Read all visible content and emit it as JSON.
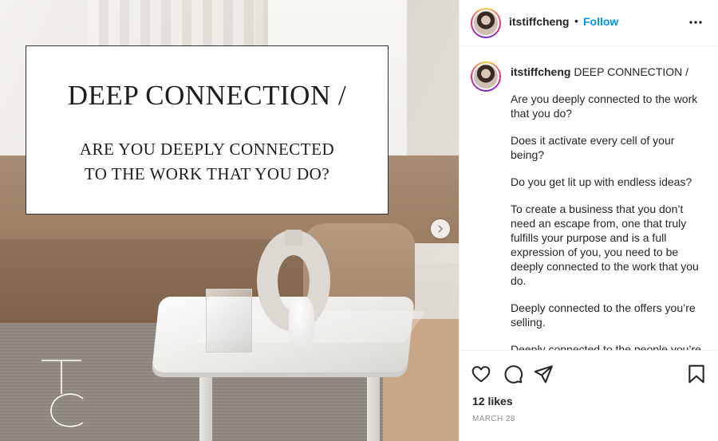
{
  "post_image": {
    "card_title": "DEEP CONNECTION /",
    "card_subtitle_line1": "ARE YOU DEEPLY CONNECTED",
    "card_subtitle_line2": "TO THE WORK THAT YOU DO?",
    "logo_letters": "TC"
  },
  "header": {
    "username": "itstiffcheng",
    "separator": "•",
    "follow_label": "Follow",
    "more_icon": "more-horizontal-icon"
  },
  "caption": {
    "username": "itstiffcheng",
    "first_line": "DEEP CONNECTION /",
    "paragraphs": [
      "Are you deeply connected to the work that you do?",
      "Does it activate every cell of your being?",
      "Do you get lit up with endless ideas?",
      "To create a business that you don’t need an escape from, one that truly fulfills your purpose and is a full expression of you, you need to be deeply connected to the work that you do.",
      "Deeply connected to the offers you’re selling.",
      "Deeply connected to the people you’re"
    ]
  },
  "actions": {
    "likes": "12 likes",
    "date": "MARCH 28",
    "icons": [
      "heart-icon",
      "comment-icon",
      "share-icon",
      "bookmark-icon"
    ]
  },
  "colors": {
    "follow_blue": "#0095f6",
    "text_dark": "#262626",
    "text_muted": "#8e8e8e"
  }
}
